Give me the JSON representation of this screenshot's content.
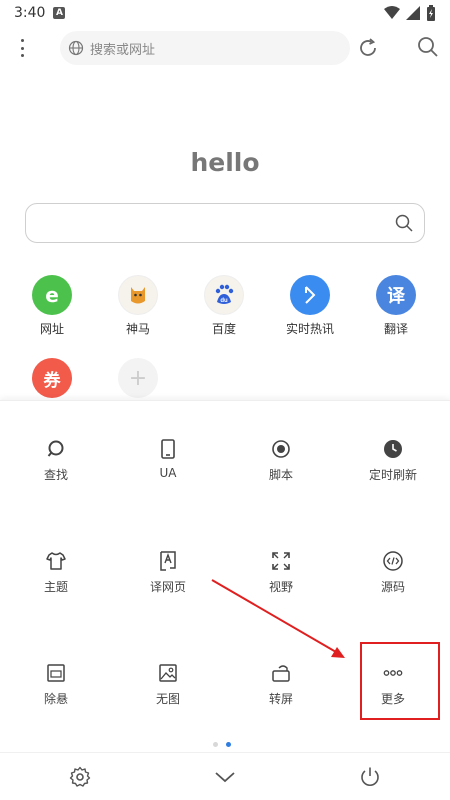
{
  "status_bar": {
    "time": "3:40",
    "app_icon_letter": "A"
  },
  "address_bar": {
    "placeholder": "搜索或网址"
  },
  "home": {
    "title": "hello"
  },
  "shortcuts": [
    {
      "label": "网址",
      "glyph": "e",
      "color": "#4cc24c"
    },
    {
      "label": "神马",
      "glyph": "",
      "color": "#f6f2ec"
    },
    {
      "label": "百度",
      "glyph": "du",
      "color": "#f6f2ec"
    },
    {
      "label": "实时热讯",
      "glyph": "",
      "color": "#3b8cf0"
    },
    {
      "label": "翻译",
      "glyph": "译",
      "color": "#4a86e0"
    },
    {
      "label": "",
      "glyph": "券",
      "color": "#f25a4a"
    },
    {
      "label": "",
      "glyph": "+",
      "color": "#f3f3f3"
    }
  ],
  "menu": [
    {
      "label": "查找",
      "icon": "search-icon"
    },
    {
      "label": "UA",
      "icon": "phone-icon"
    },
    {
      "label": "脚本",
      "icon": "record-icon"
    },
    {
      "label": "定时刷新",
      "icon": "clock-icon"
    },
    {
      "label": "主题",
      "icon": "tshirt-icon"
    },
    {
      "label": "译网页",
      "icon": "translate-page-icon"
    },
    {
      "label": "视野",
      "icon": "expand-icon"
    },
    {
      "label": "源码",
      "icon": "code-icon"
    },
    {
      "label": "除悬",
      "icon": "remove-float-icon"
    },
    {
      "label": "无图",
      "icon": "image-icon"
    },
    {
      "label": "转屏",
      "icon": "rotate-icon"
    },
    {
      "label": "更多",
      "icon": "more-icon"
    }
  ],
  "page_indicator": {
    "pages": 2,
    "active": 1,
    "active_color": "#2f7de1",
    "inactive_color": "#d8d8d8"
  },
  "annotation": {
    "color": "#e02020"
  },
  "bottom_bar": {
    "left_icon": "gear-icon",
    "center_icon": "chevron-down-icon",
    "right_icon": "power-icon"
  }
}
